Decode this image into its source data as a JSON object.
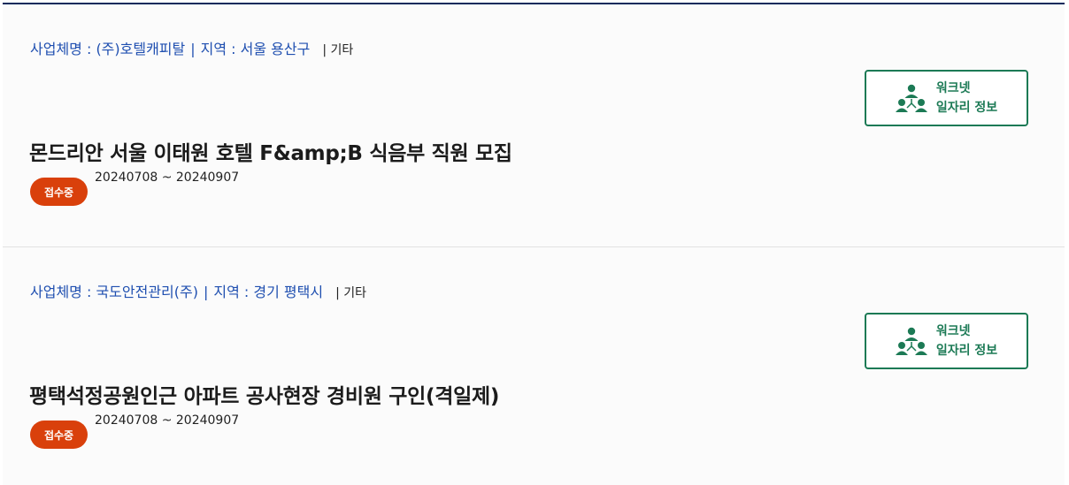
{
  "colors": {
    "accent_navy": "#0a2a5c",
    "meta_blue": "#1f4fb0",
    "badge_orange": "#d9400b",
    "worknet_green": "#1c7a55"
  },
  "listings": [
    {
      "meta": {
        "company_label": "사업체명 : (주)호텔캐피탈",
        "sep": "|",
        "region_label": "지역 : 서울 용산구",
        "etc": "| 기타"
      },
      "worknet": {
        "line1": "워크넷",
        "line2": "일자리 정보",
        "icon": "people-network-icon"
      },
      "title": "몬드리안 서울 이태원 호텔 F&amp;B 식음부 직원 모집",
      "status": "접수중",
      "period": "20240708 ~ 20240907"
    },
    {
      "meta": {
        "company_label": "사업체명 : 국도안전관리(주)",
        "sep": "|",
        "region_label": "지역 : 경기 평택시",
        "etc": "| 기타"
      },
      "worknet": {
        "line1": "워크넷",
        "line2": "일자리 정보",
        "icon": "people-network-icon"
      },
      "title": "평택석정공원인근 아파트 공사현장 경비원 구인(격일제)",
      "status": "접수중",
      "period": "20240708 ~ 20240907"
    }
  ]
}
